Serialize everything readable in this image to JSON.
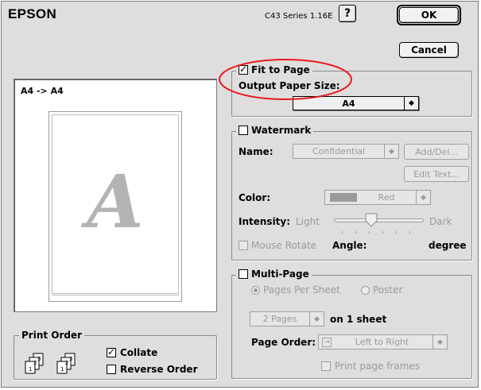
{
  "header": {
    "brand": "EPSON",
    "version": "C43 Series 1.16E",
    "help_label": "?",
    "ok_label": "OK",
    "cancel_label": "Cancel"
  },
  "preview": {
    "label": "A4 -> A4",
    "watermark_letter": "A"
  },
  "fit_to_page": {
    "label": "Fit to Page",
    "checked": true,
    "output_paper_size_label": "Output Paper Size:",
    "output_paper_size_value": "A4"
  },
  "watermark": {
    "label": "Watermark",
    "checked": false,
    "name_label": "Name:",
    "name_value": "Confidential",
    "add_del_label": "Add/Del...",
    "edit_text_label": "Edit Text...",
    "color_label": "Color:",
    "color_value": "Red",
    "color_swatch": "#9a9a9a",
    "intensity_label": "Intensity:",
    "intensity_light": "Light",
    "intensity_dark": "Dark",
    "intensity_fraction": 0.4,
    "mouse_rotate_label": "Mouse Rotate",
    "angle_label": "Angle:",
    "angle_unit": "degree"
  },
  "multi_page": {
    "label": "Multi-Page",
    "checked": false,
    "pages_per_sheet_label": "Pages Per Sheet",
    "poster_label": "Poster",
    "pages_value": "2 Pages",
    "on_sheet_label": "on 1 sheet",
    "page_order_label": "Page Order:",
    "page_order_value": "Left to Right",
    "print_frames_label": "Print page frames"
  },
  "print_order": {
    "label": "Print Order",
    "collate_label": "Collate",
    "collate_checked": true,
    "reverse_label": "Reverse Order",
    "reverse_checked": false
  },
  "colors": {
    "annotation_red": "#e8191f",
    "dialog_bg": "#dedede",
    "disabled_text": "#9a9a9a"
  }
}
